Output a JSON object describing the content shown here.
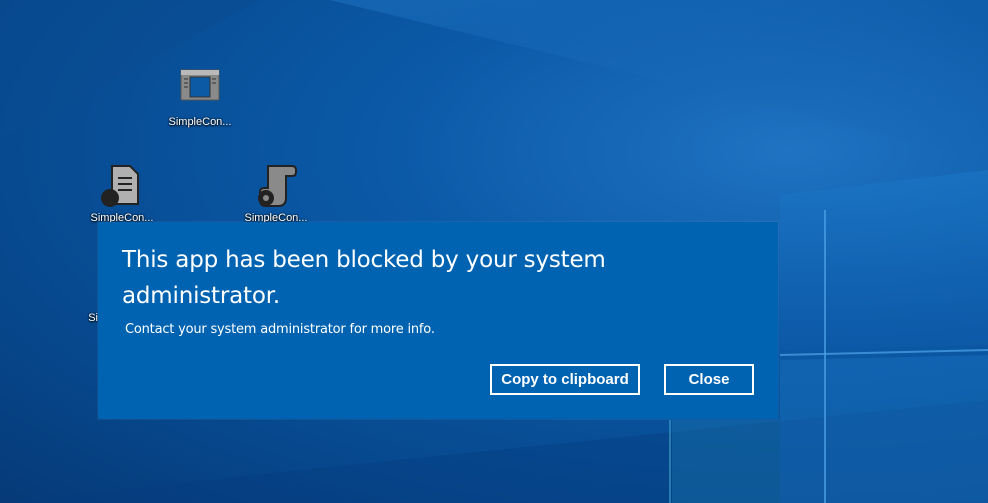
{
  "desktop": {
    "icons": [
      {
        "label": "SimpleCon..."
      },
      {
        "label": "SimpleCon..."
      },
      {
        "label": "SimpleCon..."
      },
      {
        "label": "Si"
      }
    ]
  },
  "dialog": {
    "title": "This app has been blocked by your system administrator.",
    "message": "Contact your system administrator for more info.",
    "copy_button_label": "Copy to clipboard",
    "close_button_label": "Close"
  },
  "colors": {
    "dialog_background": "#0063b1",
    "text": "#ffffff",
    "button_border": "#ffffff"
  }
}
